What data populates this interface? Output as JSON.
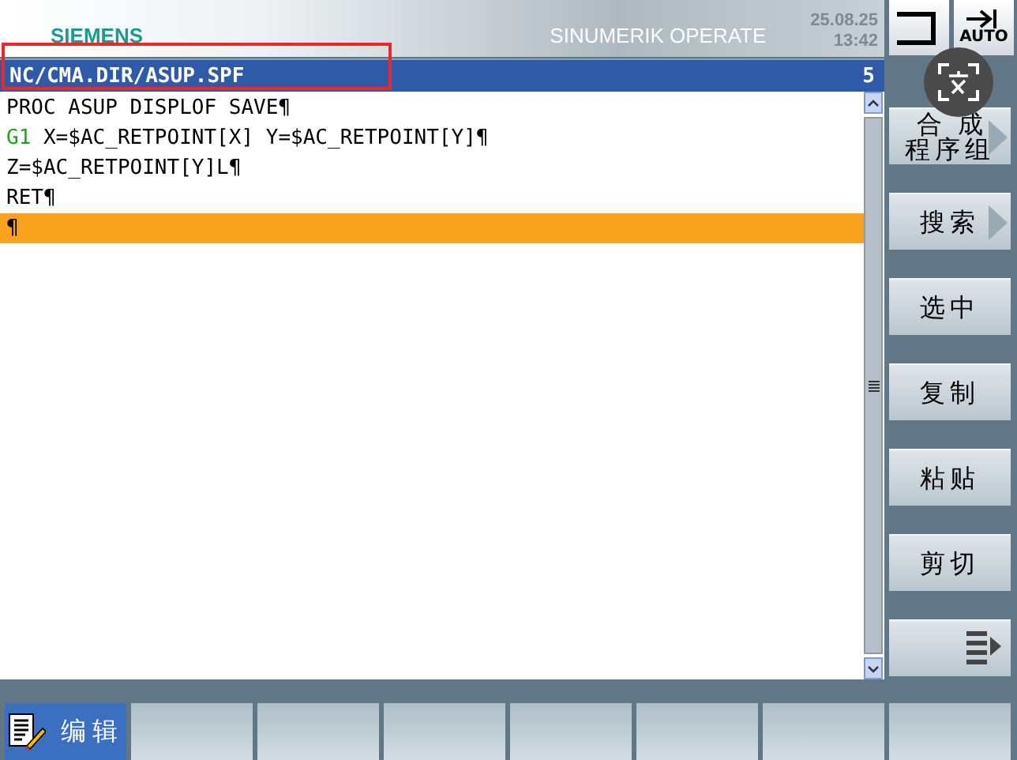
{
  "header": {
    "brand": "SIEMENS",
    "product": "SINUMERIK OPERATE",
    "date": "25.08.25",
    "time": "13:42",
    "mode": "AUTO"
  },
  "editor": {
    "path": "NC/CMA.DIR/ASUP.SPF",
    "line_number": "5",
    "lines": [
      {
        "selected": false,
        "parts": [
          {
            "kind": "plain",
            "text": "PROC ASUP DISPLOF SAVE¶"
          }
        ]
      },
      {
        "selected": false,
        "parts": [
          {
            "kind": "gcode",
            "text": "G1"
          },
          {
            "kind": "plain",
            "text": " X=$AC_RETPOINT[X] Y=$AC_RETPOINT[Y]¶"
          }
        ]
      },
      {
        "selected": false,
        "parts": [
          {
            "kind": "plain",
            "text": "Z=$AC_RETPOINT[Y]L¶"
          }
        ]
      },
      {
        "selected": false,
        "parts": [
          {
            "kind": "plain",
            "text": "RET¶"
          }
        ]
      },
      {
        "selected": true,
        "parts": [
          {
            "kind": "plain",
            "text": "¶"
          }
        ]
      }
    ]
  },
  "vertical_softkeys": [
    {
      "kind": "menu",
      "lines": [
        "合成",
        "程序组"
      ]
    },
    {
      "kind": "menu",
      "label": "搜索"
    },
    {
      "kind": "plain",
      "label": "选中"
    },
    {
      "kind": "plain",
      "label": "复制"
    },
    {
      "kind": "plain",
      "label": "粘贴"
    },
    {
      "kind": "plain",
      "label": "剪切"
    },
    {
      "kind": "more"
    }
  ],
  "horizontal_softkeys": [
    {
      "label": "编辑",
      "selected": true
    },
    {
      "selected": false
    },
    {
      "selected": false
    },
    {
      "selected": false
    },
    {
      "selected": false
    },
    {
      "selected": false
    },
    {
      "selected": false
    },
    {
      "selected": false
    }
  ]
}
